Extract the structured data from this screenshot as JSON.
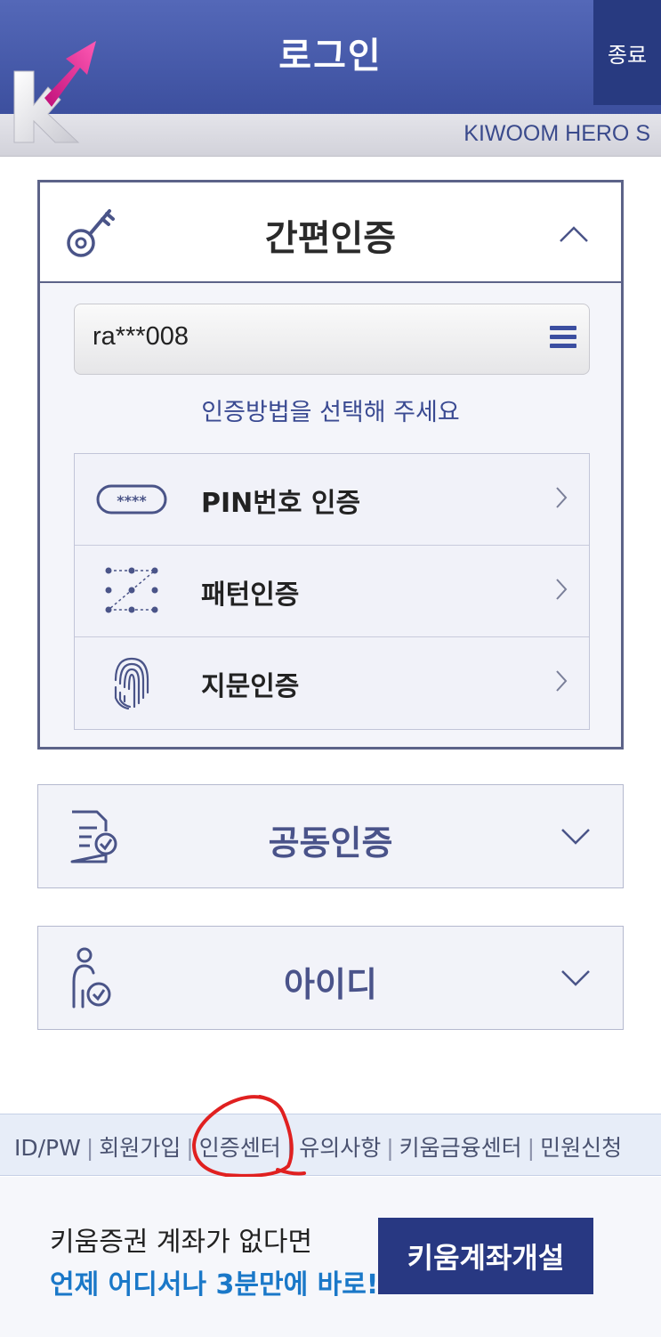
{
  "header": {
    "title": "로그인",
    "exit_label": "종료",
    "brand": "KIWOOM HERO S"
  },
  "simple_auth": {
    "title": "간편인증",
    "account_id": "ra***008",
    "guide": "인증방법을 선택해 주세요",
    "methods": [
      {
        "label": "PIN번호 인증",
        "icon": "pin-icon",
        "icon_text": "****"
      },
      {
        "label": "패턴인증",
        "icon": "pattern-icon"
      },
      {
        "label": "지문인증",
        "icon": "fingerprint-icon"
      }
    ]
  },
  "joint_auth": {
    "title": "공동인증",
    "icon": "certificate-icon"
  },
  "id_login": {
    "title": "아이디",
    "icon": "person-check-icon"
  },
  "footer_links": [
    "ID/PW",
    "회원가입",
    "인증센터",
    "유의사항",
    "키움금융센터",
    "민원신청"
  ],
  "promo": {
    "line1": "키움증권 계좌가 없다면",
    "line2": "언제 어디서나 3분만에 바로!",
    "button": "키움계좌개설"
  },
  "colors": {
    "header": "#4a5eae",
    "accent_blue": "#1a78c8",
    "button_navy": "#283882",
    "logo_pink": "#e0208c",
    "annotation_red": "#e02020"
  }
}
